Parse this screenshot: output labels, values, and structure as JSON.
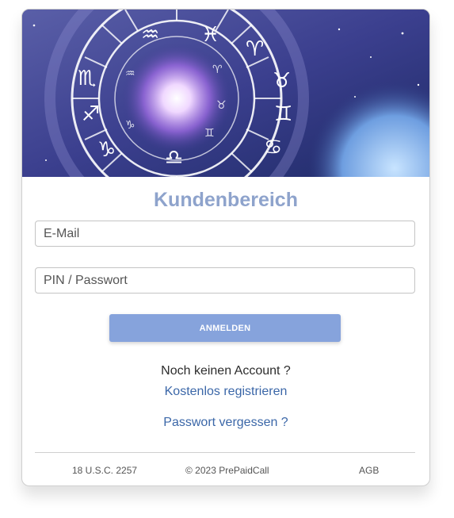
{
  "login": {
    "title": "Kundenbereich",
    "email_placeholder": "E-Mail",
    "password_placeholder": "PIN / Passwort",
    "submit_label": "ANMELDEN"
  },
  "register": {
    "prompt": "Noch keinen Account ?",
    "link_label": "Kostenlos registrieren"
  },
  "forgot": {
    "link_label": "Passwort vergessen ?"
  },
  "footer": {
    "usc": "18 U.S.C. 2257",
    "copyright": "© 2023 PrePaidCall",
    "agb": "AGB"
  },
  "colors": {
    "accent": "#86a3dc",
    "title": "#8ea3cc",
    "link": "#3b67a8"
  },
  "hero": {
    "image": "zodiac-wheel-galaxy"
  }
}
